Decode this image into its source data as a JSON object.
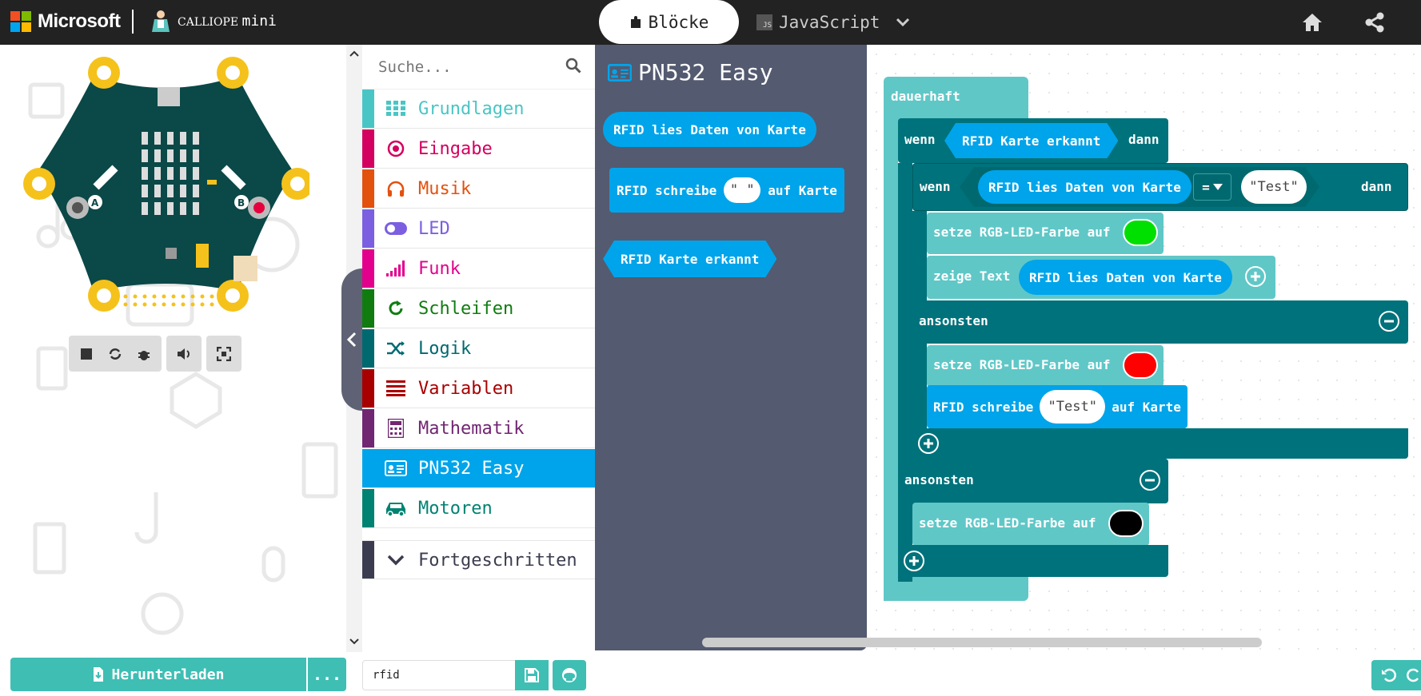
{
  "header": {
    "brand": "Microsoft",
    "product_small": "CALLIOPE",
    "product_big": "mini",
    "tabs": [
      {
        "label": "Blöcke",
        "active": true
      },
      {
        "label": "JavaScript",
        "active": false
      }
    ],
    "colors": {
      "bar": "#222222",
      "ms_red": "#f25022",
      "ms_green": "#7fba00",
      "ms_blue": "#00a4ef",
      "ms_yellow": "#ffb900"
    }
  },
  "simulator": {
    "controls": [
      "stop-icon",
      "restart-icon",
      "debug-icon",
      "mute-icon",
      "fullscreen-icon"
    ]
  },
  "toolbox": {
    "search_placeholder": "Suche...",
    "categories": [
      {
        "label": "Grundlagen",
        "color": "#4ac5c5",
        "icon": "grid-icon"
      },
      {
        "label": "Eingabe",
        "color": "#d3005f",
        "icon": "target-icon"
      },
      {
        "label": "Musik",
        "color": "#e3510f",
        "icon": "headphones-icon"
      },
      {
        "label": "LED",
        "color": "#7c5fe0",
        "icon": "toggle-icon"
      },
      {
        "label": "Funk",
        "color": "#e3008c",
        "icon": "signal-icon"
      },
      {
        "label": "Schleifen",
        "color": "#107c10",
        "icon": "refresh-icon"
      },
      {
        "label": "Logik",
        "color": "#006970",
        "icon": "shuffle-icon"
      },
      {
        "label": "Variablen",
        "color": "#a80000",
        "icon": "list-icon"
      },
      {
        "label": "Mathematik",
        "color": "#712672",
        "icon": "calculator-icon"
      },
      {
        "label": "PN532 Easy",
        "color": "#00a4ea",
        "icon": "id-card-icon",
        "selected": true
      },
      {
        "label": "Motoren",
        "color": "#008272",
        "icon": "car-icon"
      }
    ],
    "advanced": "Fortgeschritten"
  },
  "flyout": {
    "title": "PN532 Easy",
    "block_read": "RFID lies Daten von Karte",
    "block_write_prefix": "RFID schreibe",
    "block_write_value": "\" \"",
    "block_write_suffix": "auf Karte",
    "block_detected": "RFID Karte erkannt",
    "bg": "#545a70"
  },
  "workspace": {
    "forever": "dauerhaft",
    "if1": "wenn",
    "if1_cond": "RFID Karte erkannt",
    "then1": "dann",
    "if2": "wenn",
    "if2_left": "RFID lies Daten von Karte",
    "if2_op": "=",
    "if2_right": "\"Test\"",
    "then2": "dann",
    "set_rgb_1": "setze RGB-LED-Farbe auf",
    "color_1": "#00e000",
    "show_text": "zeige Text",
    "show_text_arg": "RFID lies Daten von Karte",
    "else2": "ansonsten",
    "set_rgb_2": "setze RGB-LED-Farbe auf",
    "color_2": "#ff0000",
    "write_prefix": "RFID schreibe",
    "write_value": "\"Test\"",
    "write_suffix": "auf Karte",
    "else1": "ansonsten",
    "set_rgb_3": "setze RGB-LED-Farbe auf",
    "color_3": "#000000"
  },
  "bottom": {
    "download": "Herunterladen",
    "more": "...",
    "project_name": "rfid"
  }
}
